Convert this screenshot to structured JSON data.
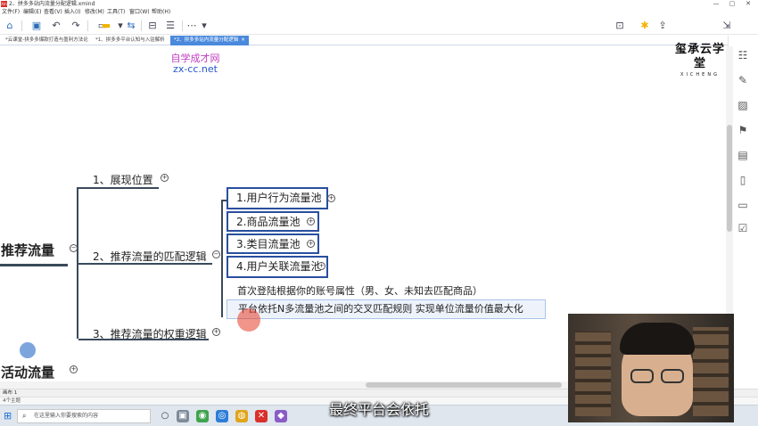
{
  "window": {
    "app_icon_text": "Xm",
    "title": "2、拼多多站内流量分配逻辑.xmind",
    "controls": [
      "—",
      "▢",
      "✕"
    ]
  },
  "menu": [
    "文件(F)",
    "编辑(E)",
    "查看(V)",
    "插入(I)",
    "修改(M)",
    "工具(T)",
    "窗口(W)",
    "帮助(H)"
  ],
  "tabs": [
    {
      "label": "*云课堂-拼多多爆款打造与盈利方法论",
      "active": false
    },
    {
      "label": "*1、拼多多平台认知与入驻解析",
      "active": false
    },
    {
      "label": "*2、拼多多站内流量分配逻辑",
      "active": true
    }
  ],
  "watermark": {
    "line1": "自学成才网",
    "line2": "zx-cc.net"
  },
  "brand": {
    "name": "玺承云学堂",
    "sub": "XICHENG"
  },
  "mindmap": {
    "central_1": "推荐流量",
    "central_2": "活动流量",
    "branch_1": "1、展现位置",
    "branch_2": "2、推荐流量的匹配逻辑",
    "branch_3": "3、推荐流量的权重逻辑",
    "pools": [
      "1.用户行为流量池",
      "2.商品流量池",
      "3.类目流量池",
      "4.用户关联流量池"
    ],
    "note_1": "首次登陆根据你的账号属性（男、女、未知去匹配商品）",
    "note_2": "平台依托N多流量池之间的交叉匹配规则 实现单位流量价值最大化"
  },
  "sheet_tab": "画布 1",
  "status": "4个主题",
  "taskbar": {
    "search_placeholder": "在这里输入你要搜索的内容"
  },
  "subtitle": "最终平台会依托",
  "colors": {
    "box_border": "#2a4f9e",
    "highlight": "#eef3fb",
    "tab_active": "#4a89dc"
  }
}
